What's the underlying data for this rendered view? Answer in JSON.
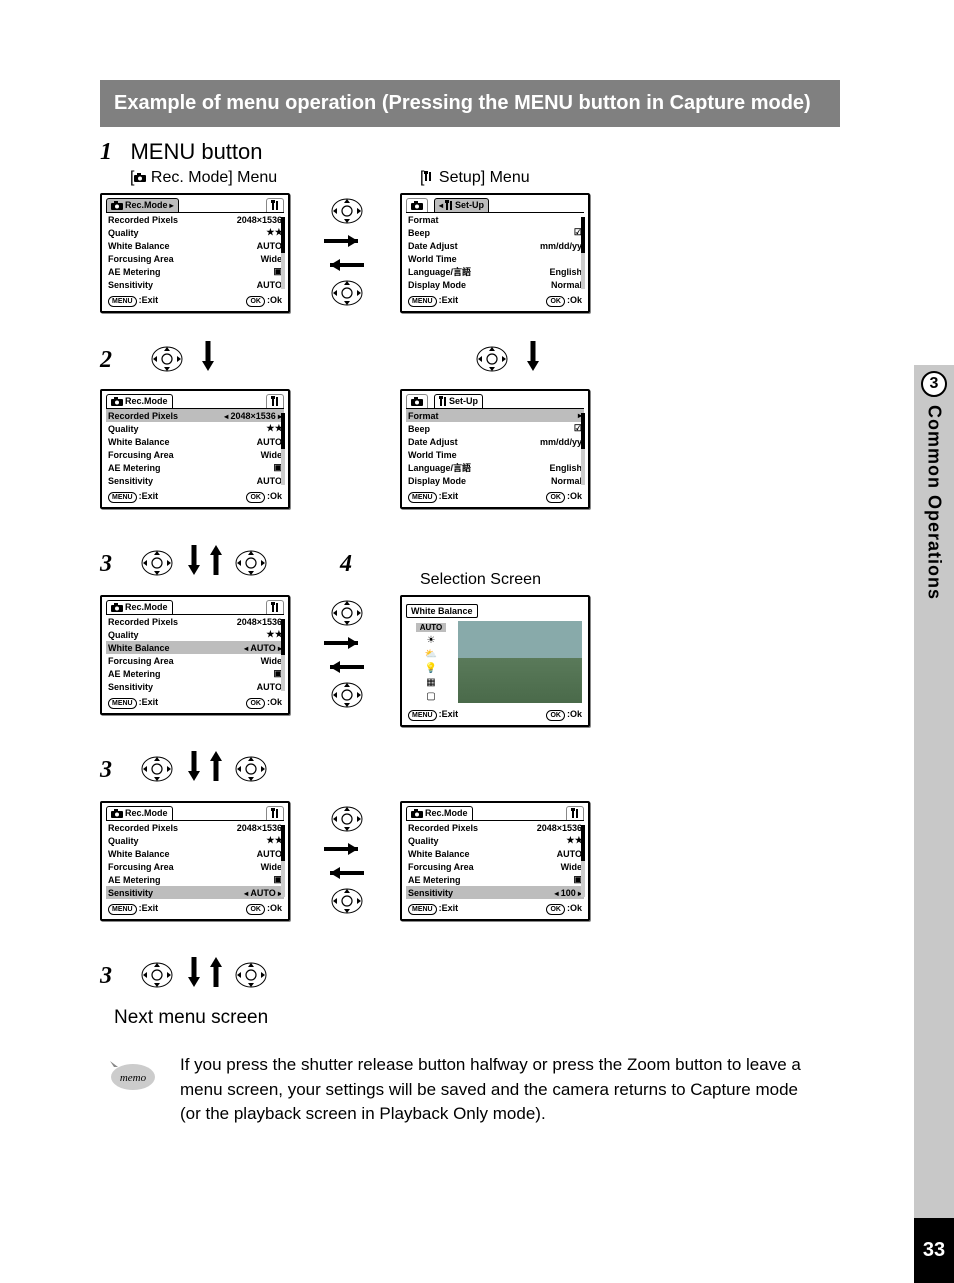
{
  "page_number": "33",
  "chapter_number": "3",
  "chapter_title": "Common Operations",
  "title": "Example of menu operation (Pressing the MENU button in Capture mode)",
  "step1_heading": "MENU button",
  "rec_mode_menu_label": "[📷 Rec. Mode] Menu",
  "setup_menu_label": "[🔧 Setup] Menu",
  "steps": {
    "s1": "1",
    "s2": "2",
    "s3": "3",
    "s4": "4"
  },
  "selection_screen_label": "Selection Screen",
  "next_menu_label": "Next menu screen",
  "memo_label": "memo",
  "memo_text": "If you press the shutter release button halfway or press the Zoom button to leave a menu screen, your settings will be saved and the camera returns to Capture mode (or the playback screen in Playback Only mode).",
  "footer": {
    "menu": "MENU",
    "exit": ":Exit",
    "ok_btn": "OK",
    "ok": ":Ok"
  },
  "rec_tab": "Rec.Mode",
  "setup_tab": "Set-Up",
  "rec_rows": {
    "recorded_pixels": "Recorded Pixels",
    "quality": "Quality",
    "white_balance": "White Balance",
    "focusing_area": "Forcusing Area",
    "ae_metering": "AE Metering",
    "sensitivity": "Sensitivity"
  },
  "rec_vals": {
    "pixels": "2048×1536",
    "quality": "★ ★",
    "wb": "AUTO",
    "focus": "Wide",
    "ae": "▣",
    "sens": "AUTO",
    "sens_100": "100"
  },
  "setup_rows": {
    "format": "Format",
    "beep": "Beep",
    "date_adjust": "Date Adjust",
    "world_time": "World Time",
    "language": "Language/言語",
    "display_mode": "Display Mode"
  },
  "setup_vals": {
    "beep": "☑",
    "date": "mm/dd/yy",
    "lang": "English",
    "display": "Normal"
  },
  "wb": {
    "title": "White Balance",
    "auto": "AUTO"
  }
}
